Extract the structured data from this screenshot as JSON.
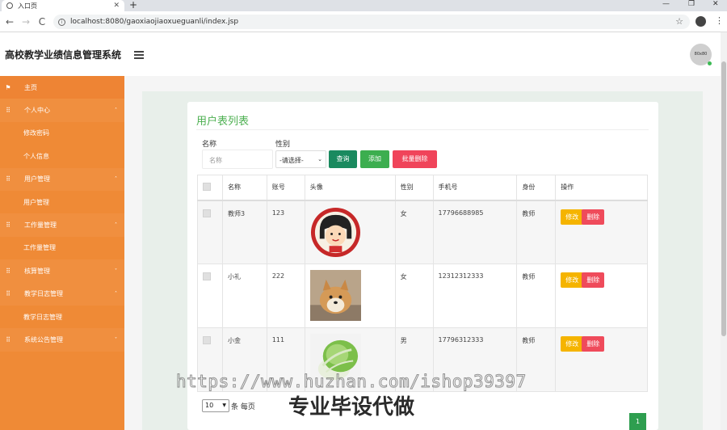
{
  "browser": {
    "tab_title": "入口页",
    "tab_close": "✕",
    "new_tab": "+",
    "url": "localhost:8080/gaoxiaojiaoxueguanli/index.jsp",
    "back": "←",
    "forward": "→",
    "reload": "C",
    "star": "☆",
    "menu": "⋮",
    "minimize": "—",
    "restore": "❐",
    "close": "✕"
  },
  "header": {
    "title": "高校教学业绩信息管理系统",
    "avatar_text": "80x80"
  },
  "sidebar": {
    "items": [
      {
        "label": "主页",
        "icon": "flag-icon",
        "glyph": "⚑",
        "type": "home"
      },
      {
        "label": "个人中心",
        "icon": "grid-icon",
        "glyph": "⠿",
        "type": "group",
        "caret": "˄"
      },
      {
        "label": "修改密码",
        "type": "sub"
      },
      {
        "label": "个人信息",
        "type": "sub"
      },
      {
        "label": "用户管理",
        "icon": "grid-icon",
        "glyph": "⠿",
        "type": "group",
        "caret": "˄"
      },
      {
        "label": "用户管理",
        "type": "sub"
      },
      {
        "label": "工作量管理",
        "icon": "grid-icon",
        "glyph": "⠿",
        "type": "group",
        "caret": "˄"
      },
      {
        "label": "工作量管理",
        "type": "sub"
      },
      {
        "label": "核算管理",
        "icon": "grid-icon",
        "glyph": "⠿",
        "type": "group",
        "caret": "˅"
      },
      {
        "label": "教学日志管理",
        "icon": "grid-icon",
        "glyph": "⠿",
        "type": "group",
        "caret": "˄"
      },
      {
        "label": "教学日志管理",
        "type": "sub"
      },
      {
        "label": "系统公告管理",
        "icon": "grid-icon",
        "glyph": "⠿",
        "type": "group",
        "caret": "˅"
      }
    ]
  },
  "main": {
    "card_title": "用户表列表",
    "search": {
      "name_label": "名称",
      "name_placeholder": "名称",
      "gender_label": "性别",
      "gender_selected": "-请选择-",
      "query_button": "查询",
      "add_button": "添加",
      "batch_delete_button": "批量删除"
    },
    "table": {
      "columns": [
        "",
        "名称",
        "账号",
        "头像",
        "性别",
        "手机号",
        "身份",
        "操作"
      ],
      "rows": [
        {
          "name": "教师3",
          "account": "123",
          "avatar": "cartoon-girl-avatar",
          "gender": "女",
          "phone": "17796688985",
          "role": "教师"
        },
        {
          "name": "小礼",
          "account": "222",
          "avatar": "shiba-dog-photo",
          "gender": "女",
          "phone": "12312312333",
          "role": "教师"
        },
        {
          "name": "小金",
          "account": "111",
          "avatar": "cabbage-photo",
          "gender": "男",
          "phone": "17796312333",
          "role": "教师"
        }
      ],
      "edit_label": "修改",
      "delete_label": "删除"
    },
    "pager": {
      "page_size": "10",
      "per_page_text": "条 每页",
      "current_page": "1"
    }
  },
  "watermark": {
    "url": "https://www.huzhan.com/ishop39397",
    "text": "专业毕设代做"
  },
  "colors": {
    "sidebar": "#ef8a36",
    "accent_green": "#4caf50",
    "query_btn": "#1a8a5f",
    "add_btn": "#3cae4f",
    "delete_btn": "#f0445a",
    "edit_btn": "#f5b400",
    "row_delete_btn": "#ef4b5b"
  }
}
